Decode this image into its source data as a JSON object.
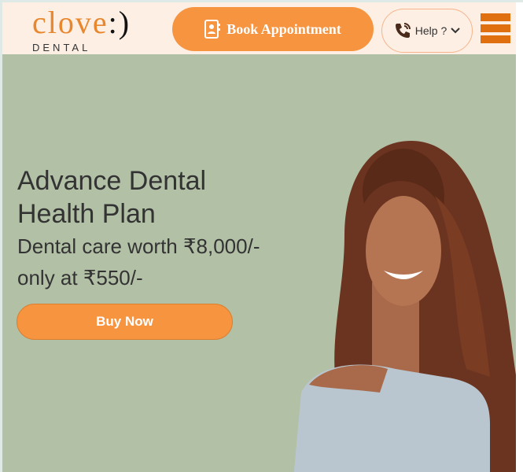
{
  "header": {
    "logo_main": "clove",
    "logo_smile": ":)",
    "logo_sub": "DENTAL",
    "book_label": "Book Appointment",
    "help_label": "Help ?"
  },
  "hero": {
    "title_line1": "Advance Dental",
    "title_line2": "Health Plan",
    "sub_line1": "Dental care worth ₹8,000/-",
    "sub_line2": "only at ₹550/-",
    "buy_label": "Buy Now"
  },
  "colors": {
    "accent": "#f79440",
    "header_bg": "#fdefe4",
    "hero_bg": "#b2c0a6",
    "menu": "#e0700f"
  }
}
